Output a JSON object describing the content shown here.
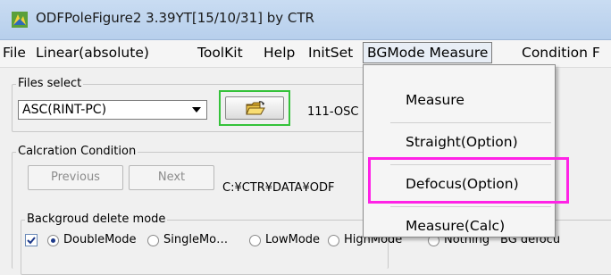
{
  "window": {
    "title": "ODFPoleFigure2 3.39YT[15/10/31] by CTR"
  },
  "menubar": {
    "items": [
      "File",
      "Linear(absolute)",
      "ToolKit",
      "Help",
      "InitSet",
      "BGMode Measure",
      "Condition F"
    ]
  },
  "dropdown": {
    "items": [
      "Measure",
      "Straight(Option)",
      "Defocus(Option)",
      "Measure(Calc)"
    ]
  },
  "files_select": {
    "legend": "Files select",
    "combo_value": "ASC(RINT-PC)",
    "path_text": "111-OSC"
  },
  "calc_condition": {
    "legend": "Calcration Condition",
    "previous_label": "Previous",
    "next_label": "Next",
    "path_text": "C:¥CTR¥DATA¥ODF"
  },
  "bg_delete": {
    "legend": "Backgroud delete mode",
    "options": [
      "DoubleMode",
      "SingleMo…",
      "LowMode",
      "HighMode",
      "Nothing",
      "BG defocu"
    ]
  },
  "colors": {
    "highlight_magenta": "#ff22e6",
    "highlight_green": "#35c23a"
  }
}
